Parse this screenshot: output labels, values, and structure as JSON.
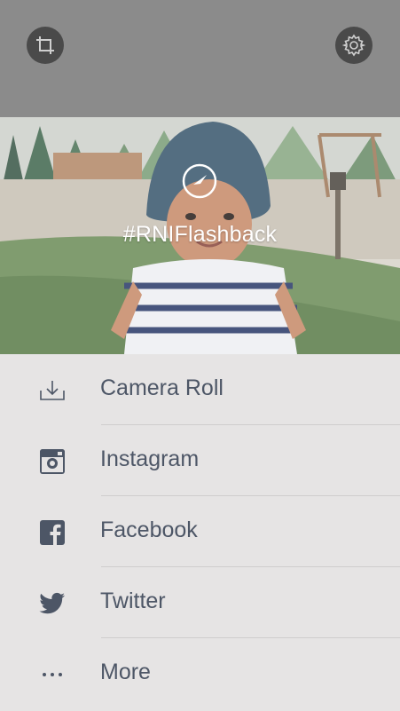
{
  "toolbar": {
    "crop_icon": "crop-icon",
    "settings_icon": "gear-icon"
  },
  "photo": {
    "hashtag": "#RNIFlashback",
    "overlay_icon": "clock-icon"
  },
  "share_options": [
    {
      "label": "Camera Roll",
      "icon": "download-icon"
    },
    {
      "label": "Instagram",
      "icon": "instagram-icon"
    },
    {
      "label": "Facebook",
      "icon": "facebook-icon"
    },
    {
      "label": "Twitter",
      "icon": "twitter-icon"
    },
    {
      "label": "More",
      "icon": "more-icon"
    }
  ],
  "colors": {
    "topbar": "#8b8b8b",
    "list_background": "#e6e4e4",
    "label_text": "#4d5666",
    "icon": "#4d5666"
  }
}
